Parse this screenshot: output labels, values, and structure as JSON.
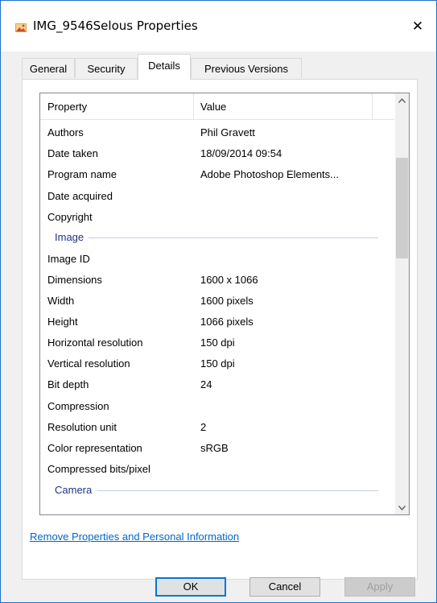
{
  "window": {
    "title": "IMG_9546Selous Properties",
    "close_glyph": "✕"
  },
  "tabs": [
    {
      "label": "General",
      "active": false
    },
    {
      "label": "Security",
      "active": false
    },
    {
      "label": "Details",
      "active": true
    },
    {
      "label": "Previous Versions",
      "active": false
    }
  ],
  "list": {
    "columns": {
      "property": "Property",
      "value": "Value"
    },
    "rows_top": [
      {
        "property": "Authors",
        "value": "Phil Gravett"
      },
      {
        "property": "Date taken",
        "value": "18/09/2014 09:54"
      },
      {
        "property": "Program name",
        "value": "Adobe Photoshop Elements..."
      },
      {
        "property": "Date acquired",
        "value": ""
      },
      {
        "property": "Copyright",
        "value": ""
      }
    ],
    "group_image": "Image",
    "rows_image": [
      {
        "property": "Image ID",
        "value": ""
      },
      {
        "property": "Dimensions",
        "value": "1600 x 1066"
      },
      {
        "property": "Width",
        "value": "1600 pixels"
      },
      {
        "property": "Height",
        "value": "1066 pixels"
      },
      {
        "property": "Horizontal resolution",
        "value": "150 dpi"
      },
      {
        "property": "Vertical resolution",
        "value": "150 dpi"
      },
      {
        "property": "Bit depth",
        "value": "24"
      },
      {
        "property": "Compression",
        "value": ""
      },
      {
        "property": "Resolution unit",
        "value": "2"
      },
      {
        "property": "Color representation",
        "value": "sRGB"
      },
      {
        "property": "Compressed bits/pixel",
        "value": ""
      }
    ],
    "group_camera": "Camera"
  },
  "remove_link": "Remove Properties and Personal Information",
  "buttons": {
    "ok": "OK",
    "cancel": "Cancel",
    "apply": "Apply"
  },
  "colors": {
    "link": "#0066cc",
    "group_title": "#1e3287",
    "default_button_border": "#0078d7"
  }
}
